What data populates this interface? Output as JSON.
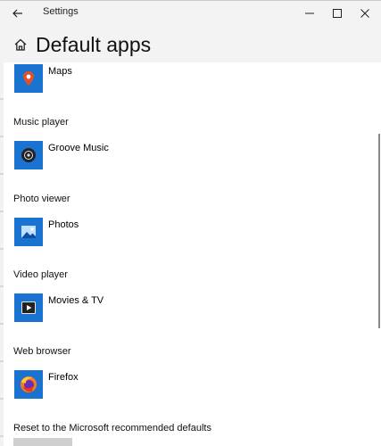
{
  "window": {
    "title": "Settings",
    "icons": {
      "back": "back-arrow-icon",
      "minimize": "minimize-icon",
      "maximize": "maximize-icon",
      "close": "close-icon"
    }
  },
  "header": {
    "title": "Default apps",
    "home_icon": "home-icon"
  },
  "maps": {
    "app_name": "Maps",
    "icon": "maps-icon"
  },
  "sections": [
    {
      "label": "Music player",
      "app_name": "Groove Music",
      "icon": "groove-music-icon"
    },
    {
      "label": "Photo viewer",
      "app_name": "Photos",
      "icon": "photos-icon"
    },
    {
      "label": "Video player",
      "app_name": "Movies & TV",
      "icon": "movies-tv-icon"
    },
    {
      "label": "Web browser",
      "app_name": "Firefox",
      "icon": "firefox-icon"
    }
  ],
  "reset": {
    "label": "Reset to the Microsoft recommended defaults"
  },
  "colors": {
    "tile_blue": "#1a73d1",
    "titlebar_bg": "#f3f3f3",
    "button_gray": "#cfcfcf"
  }
}
